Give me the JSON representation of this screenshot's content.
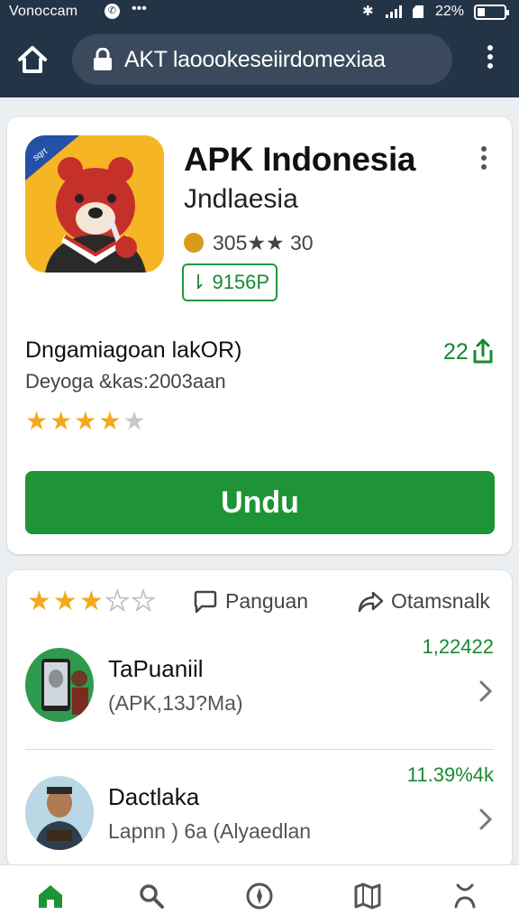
{
  "status_bar": {
    "carrier": "Vonoccam",
    "dots": "•••",
    "battery_text": "22%",
    "battery_level": 0.22
  },
  "browser": {
    "url": "AKT laoookeseiirdomexiaa"
  },
  "app": {
    "name": "APK Indonesia",
    "publisher": "Jndlaesia",
    "meta": "305★★ 30",
    "price": "⇂ 9156P",
    "title": "Dngamiagoan lakOR)",
    "subtitle": "Deyoga &kas:2003aan",
    "share_count": "22",
    "rating_stars": 4,
    "download_label": "Undu"
  },
  "review_bar": {
    "rating_stars": 3,
    "review_label": "Panguan",
    "share_label": "Otamsnalk"
  },
  "list": [
    {
      "title": "TaPuaniil",
      "subtitle": "(APK,13J?Ma)",
      "count": "1,22422"
    },
    {
      "title": "Dactlaka",
      "subtitle": "Lapnn ) 6a (Alyaedlan",
      "count": "11.39%4k"
    }
  ],
  "bottom_nav": [
    "home-icon",
    "search-icon",
    "compass-icon",
    "map-icon",
    "person-icon"
  ],
  "colors": {
    "header_bg": "#243447",
    "accent_green": "#1e9437",
    "star_orange": "#f3a91b"
  }
}
